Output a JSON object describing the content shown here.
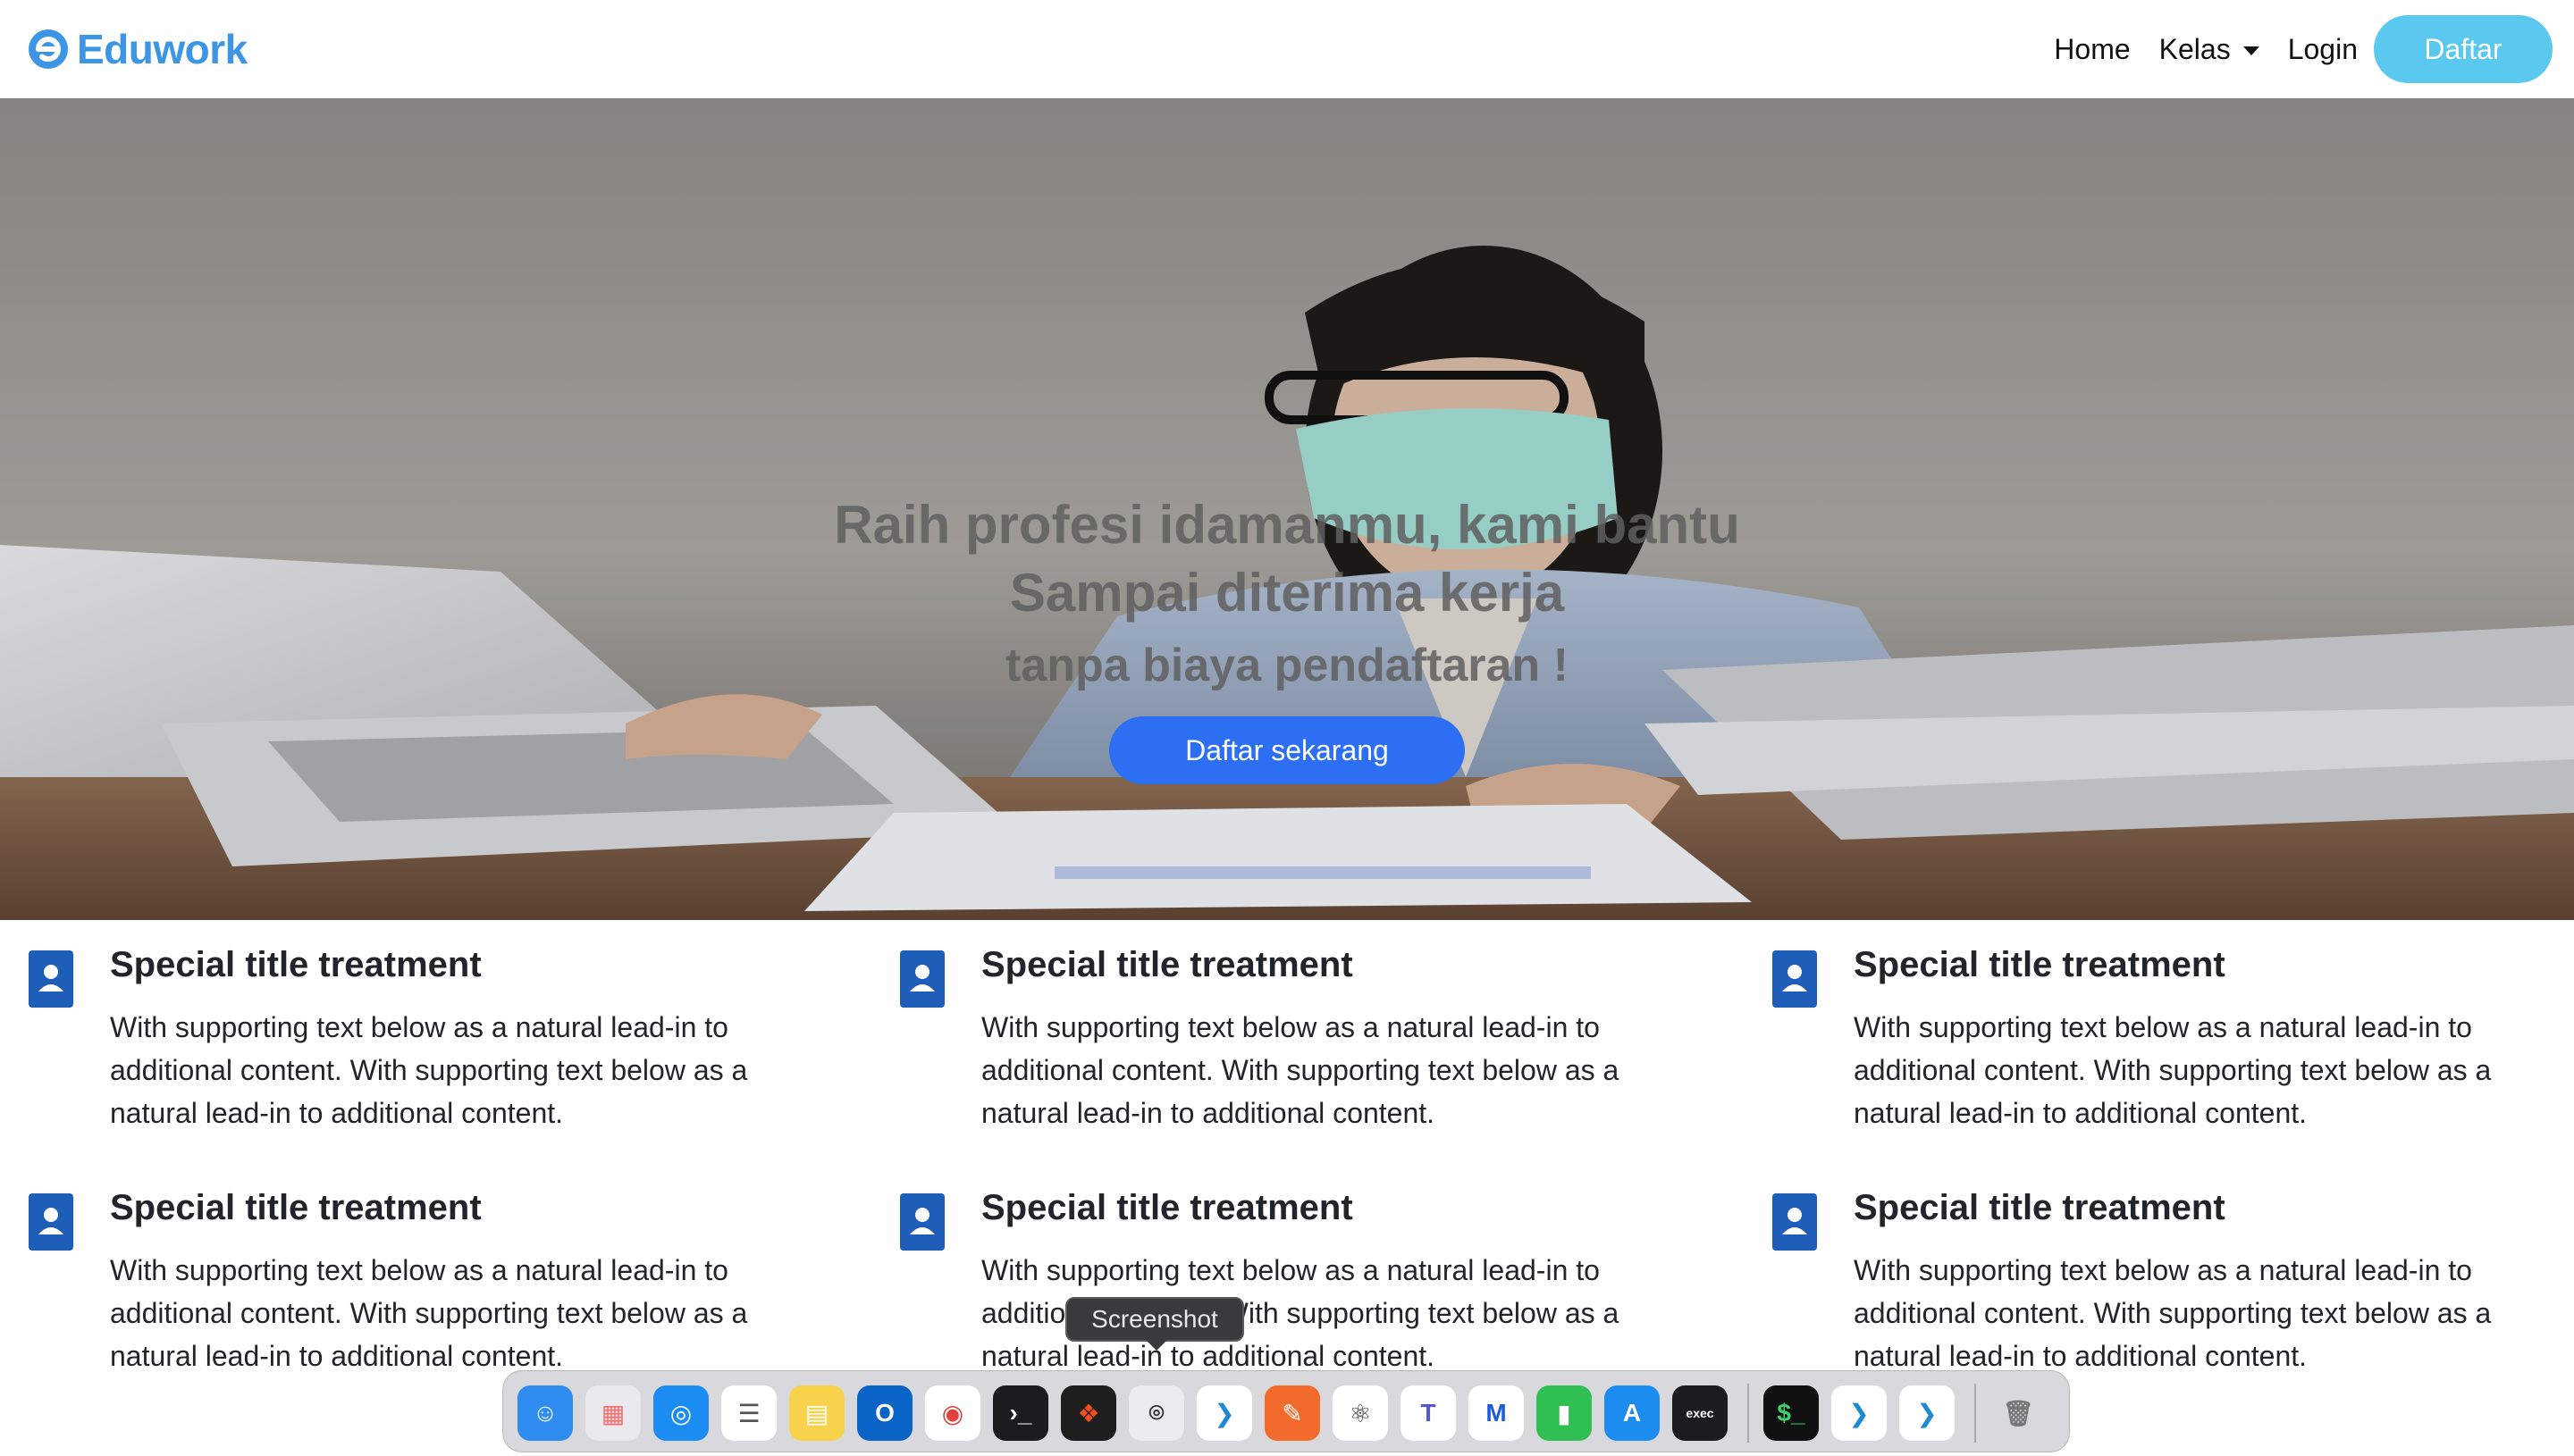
{
  "brand": {
    "name": "Eduwork",
    "color": "#3d95e6"
  },
  "nav": {
    "home": "Home",
    "kelas": "Kelas",
    "login": "Login",
    "daftar": "Daftar"
  },
  "hero": {
    "title_line1": "Raih profesi idamanmu, kami bantu",
    "title_line2": "Sampai diterima kerja",
    "subtitle": "tanpa biaya pendaftaran !",
    "cta": "Daftar sekarang"
  },
  "features": [
    {
      "title": "Special title treatment",
      "text": "With supporting text below as a natural lead-in to additional content. With supporting text below as a natural lead-in to additional content.",
      "icon": "person-badge-icon"
    },
    {
      "title": "Special title treatment",
      "text": "With supporting text below as a natural lead-in to additional content. With supporting text below as a natural lead-in to additional content.",
      "icon": "person-badge-icon"
    },
    {
      "title": "Special title treatment",
      "text": "With supporting text below as a natural lead-in to additional content. With supporting text below as a natural lead-in to additional content.",
      "icon": "person-badge-icon"
    },
    {
      "title": "Special title treatment",
      "text": "With supporting text below as a natural lead-in to additional content. With supporting text below as a natural lead-in to additional content.",
      "icon": "person-badge-icon"
    },
    {
      "title": "Special title treatment",
      "text": "With supporting text below as a natural lead-in to additional content. With supporting text below as a natural lead-in to additional content.",
      "icon": "person-badge-icon"
    },
    {
      "title": "Special title treatment",
      "text": "With supporting text below as a natural lead-in to additional content. With supporting text below as a natural lead-in to additional content.",
      "icon": "person-badge-icon"
    }
  ],
  "dock": {
    "tooltip": "Screenshot",
    "apps": [
      {
        "name": "finder-icon",
        "color": "#2f8cf0"
      },
      {
        "name": "launchpad-icon",
        "color": "#e9e9ee"
      },
      {
        "name": "safari-icon",
        "color": "#1b8cf2"
      },
      {
        "name": "reminders-icon",
        "color": "#ffffff"
      },
      {
        "name": "notes-icon",
        "color": "#f8d24a"
      },
      {
        "name": "outlook-icon",
        "color": "#0a64c8"
      },
      {
        "name": "chrome-icon",
        "color": "#ffffff"
      },
      {
        "name": "terminal-icon",
        "color": "#1c1c1e"
      },
      {
        "name": "figma-icon",
        "color": "#1e1e1e"
      },
      {
        "name": "screenshot-icon",
        "color": "#ececef"
      },
      {
        "name": "vscode-icon",
        "color": "#ffffff"
      },
      {
        "name": "pencil-app-icon",
        "color": "#f26b2c"
      },
      {
        "name": "electron-icon",
        "color": "#ffffff"
      },
      {
        "name": "teams-icon",
        "color": "#ffffff"
      },
      {
        "name": "rider-icon",
        "color": "#ffffff"
      },
      {
        "name": "numbers-icon",
        "color": "#2fbf52"
      },
      {
        "name": "app-store-icon",
        "color": "#1d8cf0"
      },
      {
        "name": "exec-icon",
        "color": "#1c1c1e"
      },
      {
        "name": "iterm-icon",
        "color": "#111111"
      },
      {
        "name": "vscode-icon-2",
        "color": "#ffffff"
      },
      {
        "name": "vscode-insiders-icon",
        "color": "#ffffff"
      },
      {
        "name": "trash-icon",
        "color": "#d9d9dc"
      }
    ],
    "colors": {
      "dock_bg": "#d2d2d7",
      "tooltip_bg": "#3a3a3c"
    }
  },
  "colors": {
    "primary_button": "#2c6ff2",
    "nav_button": "#5bc8f0",
    "feature_icon": "#1e5eb8"
  }
}
